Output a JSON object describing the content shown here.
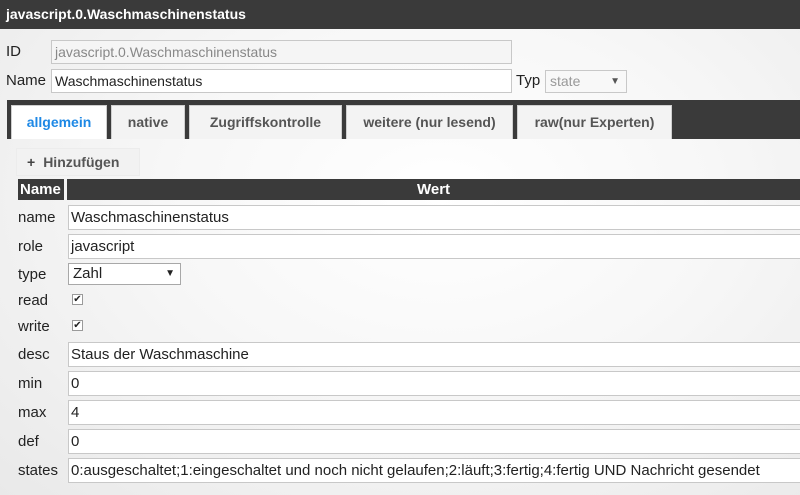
{
  "window": {
    "title": "javascript.0.Waschmaschinenstatus"
  },
  "header": {
    "id_label": "ID",
    "id_value": "javascript.0.Waschmaschinenstatus",
    "name_label": "Name",
    "name_value": "Waschmaschinenstatus",
    "typ_label": "Typ",
    "typ_value": "state"
  },
  "tabs": [
    {
      "label": "allgemein",
      "active": true
    },
    {
      "label": "native"
    },
    {
      "label": "Zugriffskontrolle"
    },
    {
      "label": "weitere (nur lesend)"
    },
    {
      "label": "raw(nur Experten)"
    }
  ],
  "add_button": {
    "label": "Hinzufügen",
    "icon": "plus-icon"
  },
  "table": {
    "headers": {
      "name": "Name",
      "value": "Wert"
    },
    "rows": {
      "name": {
        "label": "name",
        "value": "Waschmaschinenstatus"
      },
      "role": {
        "label": "role",
        "value": "javascript"
      },
      "type": {
        "label": "type",
        "value": "Zahl"
      },
      "read": {
        "label": "read",
        "checked": true
      },
      "write": {
        "label": "write",
        "checked": true
      },
      "desc": {
        "label": "desc",
        "value": "Staus der Waschmaschine"
      },
      "min": {
        "label": "min",
        "value": "0"
      },
      "max": {
        "label": "max",
        "value": "4"
      },
      "def": {
        "label": "def",
        "value": "0"
      },
      "states": {
        "label": "states",
        "value": "0:ausgeschaltet;1:eingeschaltet und noch nicht gelaufen;2:läuft;3:fertig;4:fertig UND Nachricht gesendet"
      }
    }
  },
  "colors": {
    "titlebar": "#3a3a3a",
    "active_tab": "#1e88e5"
  }
}
